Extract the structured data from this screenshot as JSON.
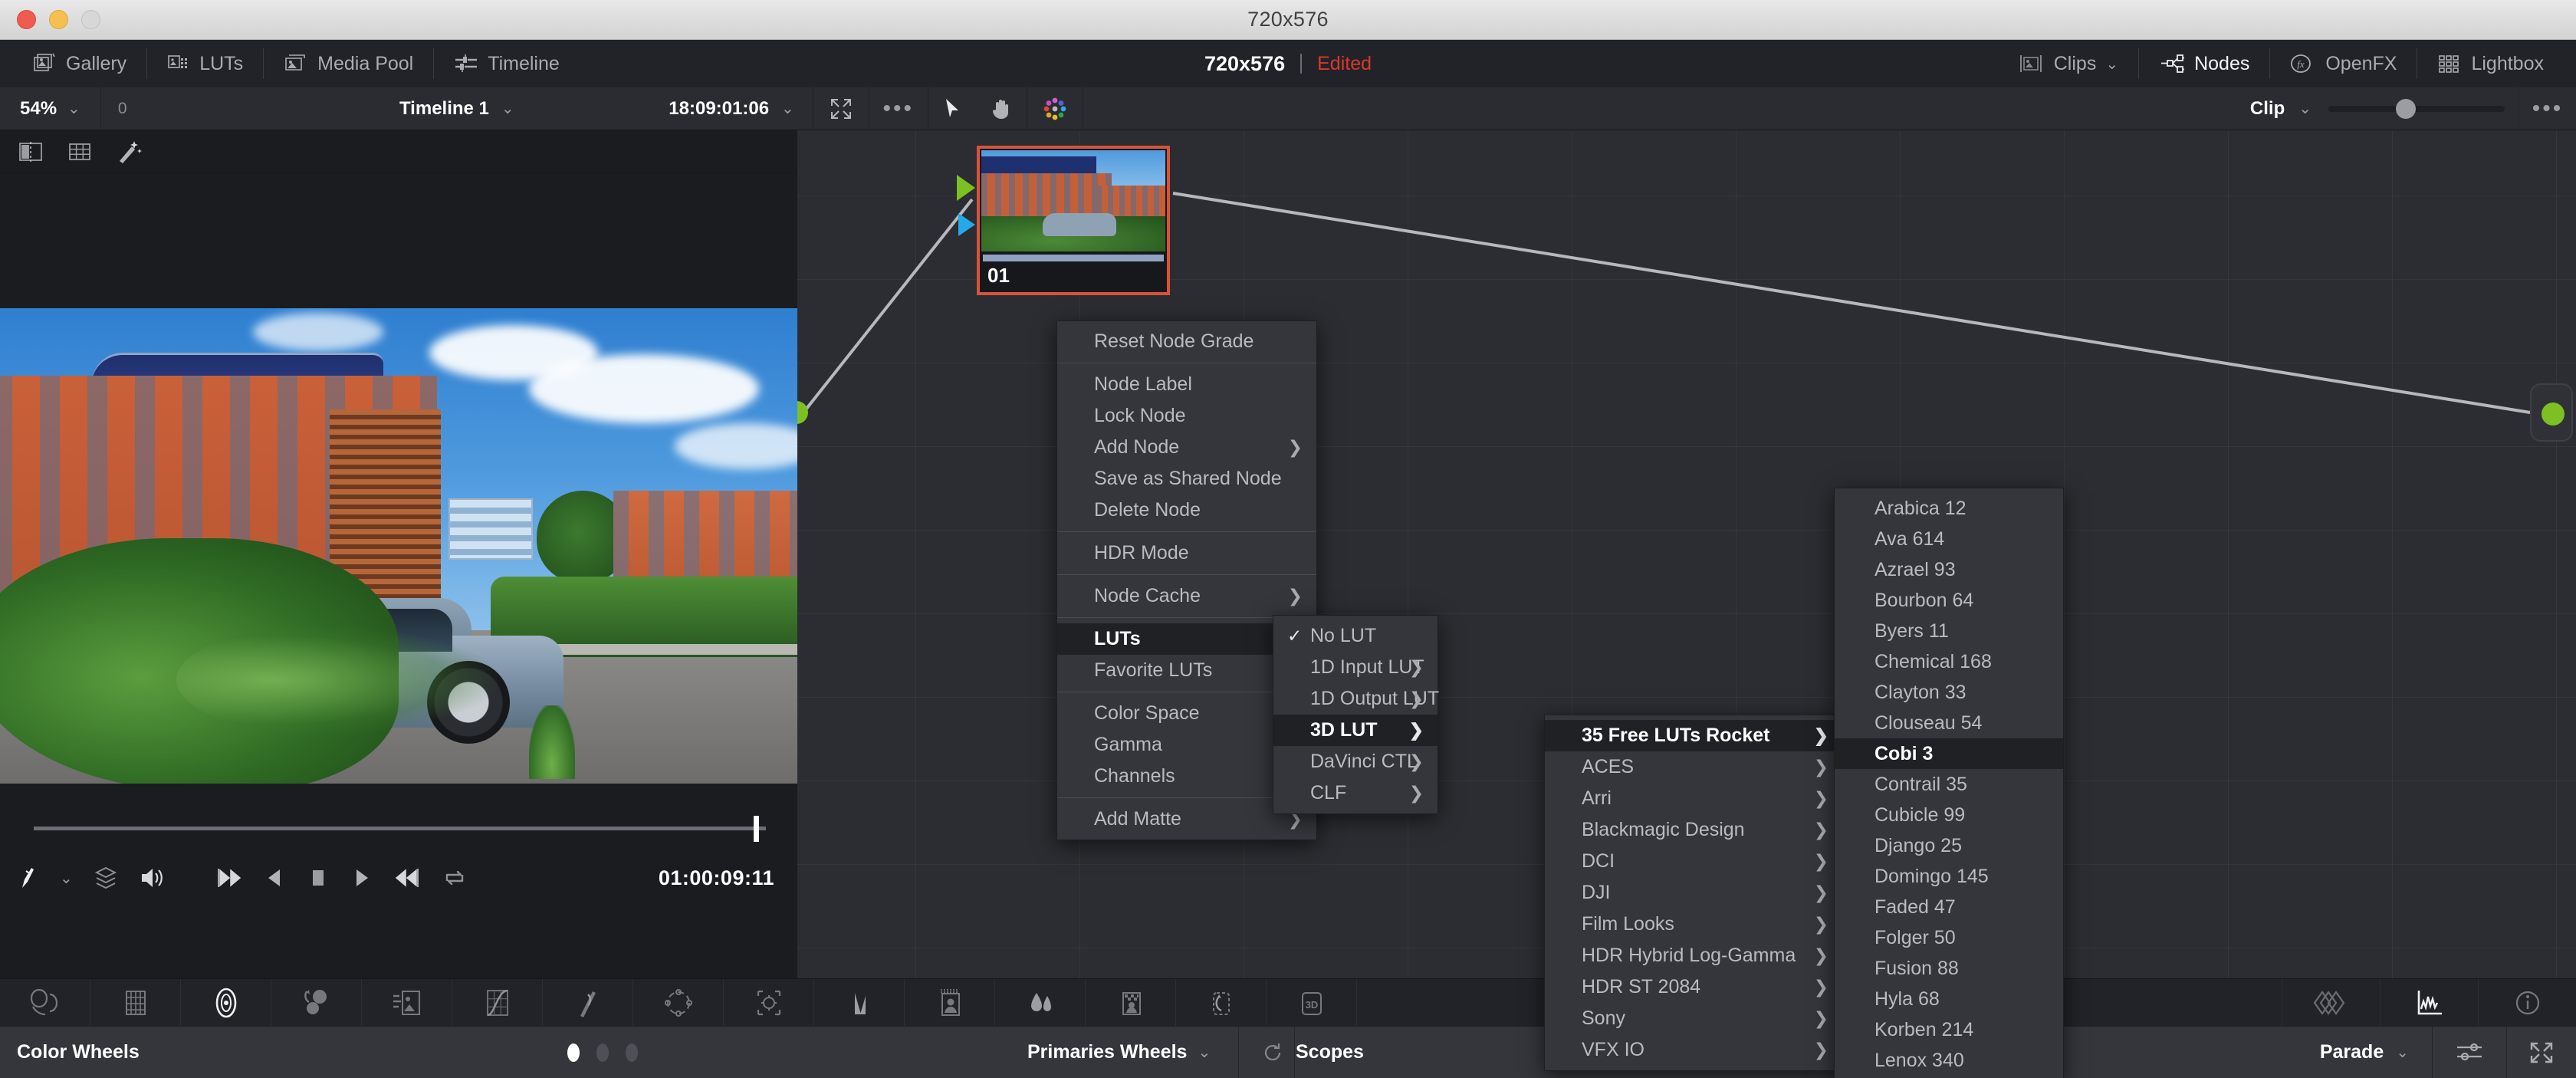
{
  "window": {
    "title": "720x576"
  },
  "toolbar": {
    "left_items": [
      {
        "label": "Gallery",
        "icon": "gallery-icon"
      },
      {
        "label": "LUTs",
        "icon": "luts-icon"
      },
      {
        "label": "Media Pool",
        "icon": "media-pool-icon"
      },
      {
        "label": "Timeline",
        "icon": "timeline-icon"
      }
    ],
    "center": {
      "resolution": "720x576",
      "status": "Edited",
      "status_color": "#d9372b"
    },
    "right_items": [
      {
        "label": "Clips",
        "icon": "clips-icon",
        "has_chevron": true,
        "active": false
      },
      {
        "label": "Nodes",
        "icon": "nodes-icon",
        "has_chevron": false,
        "active": true
      },
      {
        "label": "OpenFX",
        "icon": "openfx-icon",
        "has_chevron": false,
        "active": false
      },
      {
        "label": "Lightbox",
        "icon": "lightbox-icon",
        "has_chevron": false,
        "active": false
      }
    ]
  },
  "row2": {
    "zoom": "54%",
    "clip_number": "0",
    "timeline_name": "Timeline 1",
    "timecode": "18:09:01:06",
    "fit_icon": "fit-to-screen-icon",
    "options_icon": "more-options-icon",
    "tool_pointer": "pointer-tool-icon",
    "tool_hand": "hand-tool-icon",
    "tool_colorwheel": "color-picker-icon",
    "mode_label": "Clip",
    "slider_value": 50
  },
  "viewer": {
    "tools": [
      "split-screen-icon",
      "grid-view-icon",
      "magic-wand-icon"
    ],
    "timecode": "01:00:09:11",
    "transport": [
      "go-to-first-frame-icon",
      "play-reverse-icon",
      "stop-icon",
      "play-icon",
      "go-to-last-frame-icon",
      "loop-icon"
    ],
    "left_controls": [
      "color-picker-icon",
      "chevron-down-icon",
      "stack-icon",
      "audio-icon"
    ]
  },
  "node_graph": {
    "node_label": "01",
    "selected": true,
    "input_icon": "node-input-arrow",
    "key_icon": "node-key-arrow",
    "source_icon": "source-connector-dot",
    "output_icon": "output-connector-dot"
  },
  "menus": {
    "root": {
      "name": "node-context-menu",
      "items": [
        {
          "label": "Reset Node Grade",
          "submenu": false,
          "sep_after": true
        },
        {
          "label": "Node Label",
          "submenu": false
        },
        {
          "label": "Lock Node",
          "submenu": false
        },
        {
          "label": "Add Node",
          "submenu": true
        },
        {
          "label": "Save as Shared Node",
          "submenu": false
        },
        {
          "label": "Delete Node",
          "submenu": false,
          "sep_after": true
        },
        {
          "label": "HDR Mode",
          "submenu": false,
          "sep_after": true
        },
        {
          "label": "Node Cache",
          "submenu": true,
          "sep_after": true
        },
        {
          "label": "LUTs",
          "submenu": true,
          "highlighted": true
        },
        {
          "label": "Favorite LUTs",
          "submenu": true,
          "sep_after": true
        },
        {
          "label": "Color Space",
          "submenu": true
        },
        {
          "label": "Gamma",
          "submenu": true
        },
        {
          "label": "Channels",
          "submenu": true,
          "sep_after": true
        },
        {
          "label": "Add Matte",
          "submenu": true
        }
      ]
    },
    "luts": {
      "name": "luts-submenu",
      "items": [
        {
          "label": "No LUT",
          "submenu": false,
          "checked": true
        },
        {
          "label": "1D Input LUT",
          "submenu": true
        },
        {
          "label": "1D Output LUT",
          "submenu": true
        },
        {
          "label": "3D LUT",
          "submenu": true,
          "highlighted": true
        },
        {
          "label": "DaVinci CTL",
          "submenu": true
        },
        {
          "label": "CLF",
          "submenu": true
        }
      ]
    },
    "three_d_lut": {
      "name": "3d-lut-submenu",
      "items": [
        {
          "label": "35 Free LUTs Rocket",
          "submenu": true,
          "highlighted": true
        },
        {
          "label": "ACES",
          "submenu": true
        },
        {
          "label": "Arri",
          "submenu": true
        },
        {
          "label": "Blackmagic Design",
          "submenu": true
        },
        {
          "label": "DCI",
          "submenu": true
        },
        {
          "label": "DJI",
          "submenu": true
        },
        {
          "label": "Film Looks",
          "submenu": true
        },
        {
          "label": "HDR Hybrid Log-Gamma",
          "submenu": true
        },
        {
          "label": "HDR ST 2084",
          "submenu": true
        },
        {
          "label": "Sony",
          "submenu": true
        },
        {
          "label": "VFX IO",
          "submenu": true
        }
      ]
    },
    "rocket": {
      "name": "rocket-luts-submenu",
      "items": [
        {
          "label": "Arabica 12"
        },
        {
          "label": "Ava 614"
        },
        {
          "label": "Azrael 93"
        },
        {
          "label": "Bourbon 64"
        },
        {
          "label": "Byers 11"
        },
        {
          "label": "Chemical 168"
        },
        {
          "label": "Clayton 33"
        },
        {
          "label": "Clouseau 54"
        },
        {
          "label": "Cobi 3",
          "highlighted": true
        },
        {
          "label": "Contrail 35"
        },
        {
          "label": "Cubicle 99"
        },
        {
          "label": "Django 25"
        },
        {
          "label": "Domingo 145"
        },
        {
          "label": "Faded 47"
        },
        {
          "label": "Folger 50"
        },
        {
          "label": "Fusion 88"
        },
        {
          "label": "Hyla 68"
        },
        {
          "label": "Korben 214"
        },
        {
          "label": "Lenox 340"
        }
      ]
    }
  },
  "palette": {
    "items": [
      "color-wheels-icon",
      "primaries-bars-icon",
      "log-wheels-icon",
      "rgb-mixer-icon",
      "color-match-icon",
      "curves-icon",
      "color-warper-icon",
      "qualifier-icon",
      "power-window-icon",
      "tracker-icon",
      "magic-mask-icon",
      "blur-icon",
      "key-icon",
      "sizing-icon",
      "stereo-3d-icon"
    ],
    "right_items": [
      "keyframes-icon",
      "scopes-icon",
      "info-icon"
    ]
  },
  "statusbar": {
    "left_label": "Color Wheels",
    "page_dots": 3,
    "active_dot": 0,
    "mode_select": "Primaries Wheels",
    "reset_icon": "reset-icon",
    "scopes_label": "Scopes",
    "scope_mode": "Parade",
    "settings_icon": "scope-settings-icon",
    "expand_icon": "expand-icon"
  },
  "colors": {
    "accent_red": "#d9372b",
    "node_select": "#d9533b",
    "connector_green": "#7cc024",
    "connector_blue": "#27a8e8",
    "panel_bg": "#212328",
    "menu_bg": "#34363c",
    "menu_highlight": "#1f2125"
  }
}
